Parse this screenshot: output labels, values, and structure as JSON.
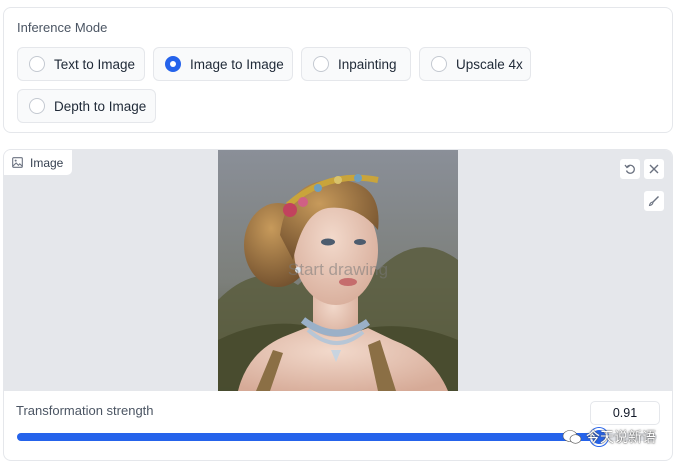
{
  "inference_mode": {
    "title": "Inference Mode",
    "options": [
      {
        "label": "Text to Image",
        "selected": false
      },
      {
        "label": "Image to Image",
        "selected": true
      },
      {
        "label": "Inpainting",
        "selected": false
      },
      {
        "label": "Upscale 4x",
        "selected": false
      },
      {
        "label": "Depth to Image",
        "selected": false
      }
    ]
  },
  "image_panel": {
    "label": "Image",
    "canvas_hint": "Start drawing",
    "icons": {
      "label": "image-icon",
      "undo": "undo-icon",
      "clear": "close-icon",
      "brush": "brush-icon"
    }
  },
  "transformation": {
    "label": "Transformation strength",
    "value": "0.91",
    "fraction": 0.91
  },
  "watermark": {
    "text": "今天说新语"
  },
  "colors": {
    "accent": "#2563eb",
    "border": "#e5e7eb",
    "canvas_bg": "#e5e7eb"
  }
}
